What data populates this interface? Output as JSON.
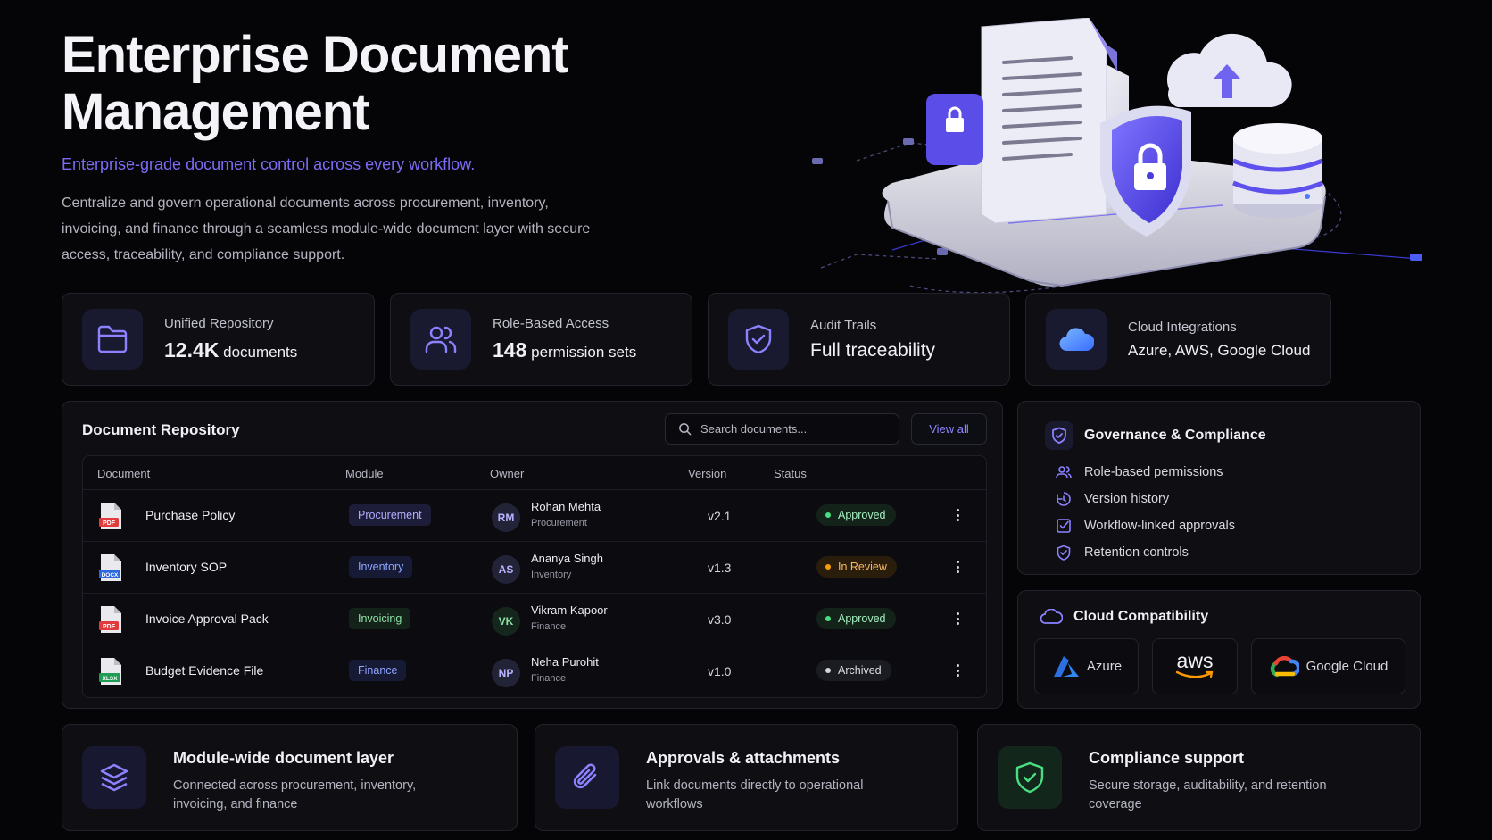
{
  "hero": {
    "title_line1": "Enterprise Document",
    "title_line2": "Management",
    "subtitle": "Enterprise-grade document control across every workflow.",
    "description": "Centralize and govern operational documents across procurement, inventory, invoicing, and finance through a seamless module-wide document layer with secure access, traceability, and compliance support."
  },
  "stats": [
    {
      "label": "Unified Repository",
      "value": "12.4K",
      "unit": "documents",
      "icon": "folder-icon"
    },
    {
      "label": "Role-Based Access",
      "value": "148",
      "unit": "permission sets",
      "icon": "users-icon"
    },
    {
      "label": "Audit Trails",
      "value": "Full traceability",
      "icon": "shield-check-icon"
    },
    {
      "label": "Cloud Integrations",
      "value": "Azure, AWS, Google Cloud",
      "icon": "cloud-icon"
    }
  ],
  "repository": {
    "title": "Document Repository",
    "search_placeholder": "Search documents...",
    "view_all": "View all",
    "columns": [
      "Document",
      "Module",
      "Owner",
      "Version",
      "Status"
    ],
    "rows": [
      {
        "name": "Purchase Policy",
        "file_type": "PDF",
        "module": "Procurement",
        "initials": "RM",
        "owner": "Rohan Mehta",
        "dept": "Procurement",
        "version": "v2.1",
        "status": "Approved"
      },
      {
        "name": "Inventory SOP",
        "file_type": "DOCX",
        "module": "Inventory",
        "initials": "AS",
        "owner": "Ananya Singh",
        "dept": "Inventory",
        "version": "v1.3",
        "status": "In Review"
      },
      {
        "name": "Invoice Approval Pack",
        "file_type": "PDF",
        "module": "Invoicing",
        "initials": "VK",
        "owner": "Vikram Kapoor",
        "dept": "Finance",
        "version": "v3.0",
        "status": "Approved"
      },
      {
        "name": "Budget Evidence File",
        "file_type": "XLSX",
        "module": "Finance",
        "initials": "NP",
        "owner": "Neha Purohit",
        "dept": "Finance",
        "version": "v1.0",
        "status": "Archived"
      }
    ]
  },
  "governance": {
    "title": "Governance & Compliance",
    "items": [
      "Role-based permissions",
      "Version history",
      "Workflow-linked approvals",
      "Retention controls"
    ]
  },
  "cloud": {
    "title": "Cloud Compatibility",
    "providers": [
      "Azure",
      "aws",
      "Google Cloud"
    ]
  },
  "features": [
    {
      "title": "Module-wide document layer",
      "desc": "Connected across procurement, inventory, invoicing, and finance"
    },
    {
      "title": "Approvals & attachments",
      "desc": "Link documents directly to operational workflows"
    },
    {
      "title": "Compliance support",
      "desc": "Secure storage, auditability, and retention coverage"
    }
  ],
  "colors": {
    "accent": "#7b6cf6",
    "approved": "#4ade80",
    "in_review": "#f59e0b",
    "archived": "#d4d4dc"
  }
}
